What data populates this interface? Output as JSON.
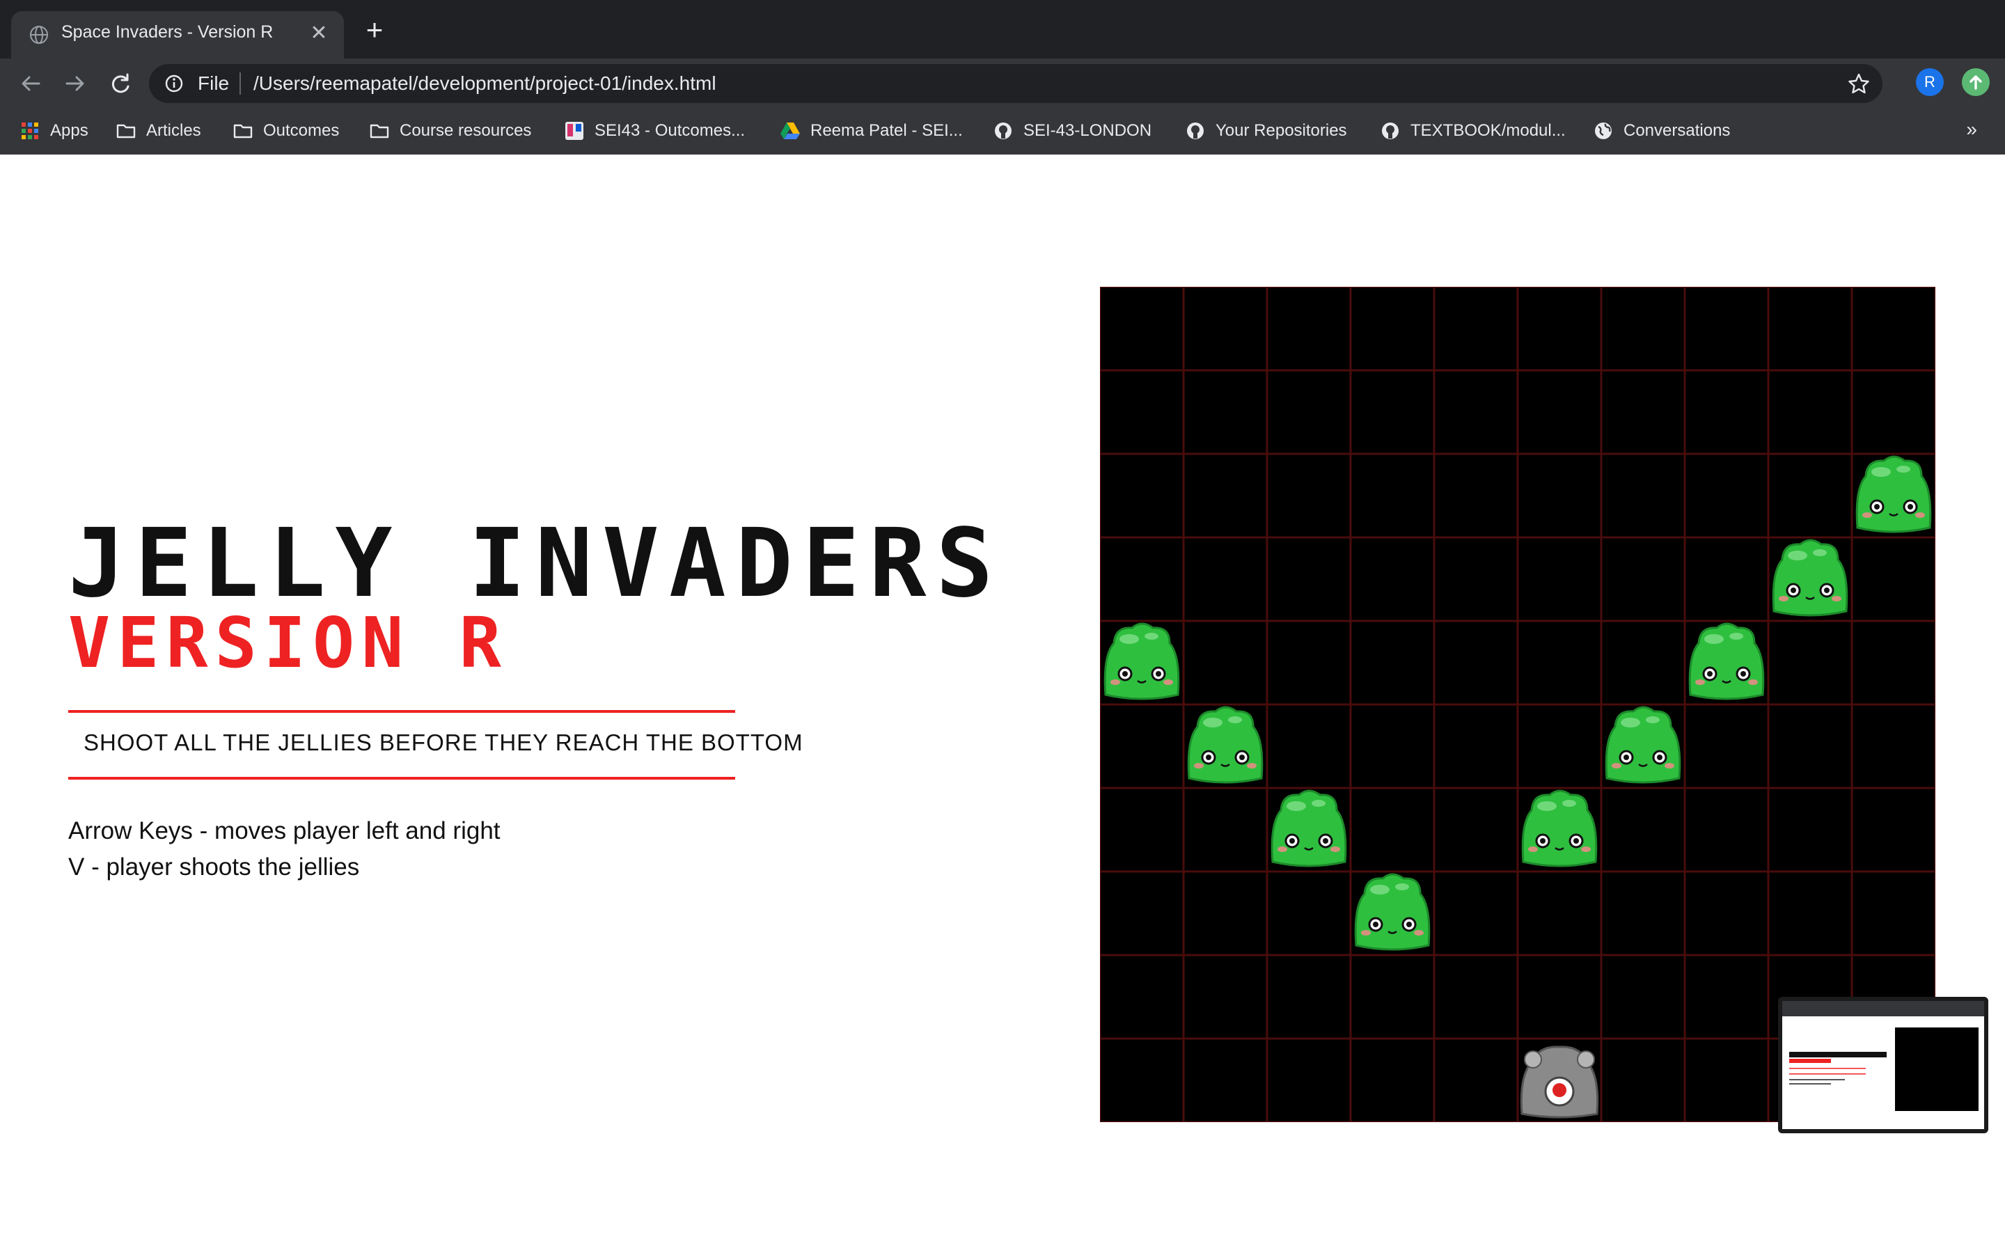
{
  "browser": {
    "tab": {
      "title": "Space Invaders - Version R",
      "close_label": "✕"
    },
    "new_tab_label": "+",
    "address": {
      "scheme": "File",
      "url": "/Users/reemapatel/development/project-01/index.html"
    },
    "profile_initial": "R",
    "bookmarks": [
      {
        "label": "Apps",
        "icon": "apps-grid-icon"
      },
      {
        "label": "Articles",
        "icon": "folder-icon"
      },
      {
        "label": "Outcomes",
        "icon": "folder-icon"
      },
      {
        "label": "Course resources",
        "icon": "folder-icon"
      },
      {
        "label": "SEI43 - Outcomes...",
        "icon": "trello-icon"
      },
      {
        "label": "Reema Patel - SEI...",
        "icon": "google-drive-icon"
      },
      {
        "label": "SEI-43-LONDON",
        "icon": "github-icon"
      },
      {
        "label": "Your Repositories",
        "icon": "github-icon"
      },
      {
        "label": "TEXTBOOK/modul...",
        "icon": "github-icon"
      },
      {
        "label": "Conversations",
        "icon": "globe-icon"
      }
    ],
    "more_label": "»"
  },
  "page": {
    "title": "JELLY INVADERS",
    "subtitle": "VERSION R",
    "tagline": "SHOOT ALL THE JELLIES BEFORE THEY REACH THE BOTTOM",
    "instructions": [
      "Arrow Keys - moves player left and right",
      "V - player shoots the jellies"
    ]
  },
  "game": {
    "rows": 10,
    "cols": 10,
    "colors": {
      "background": "#000000",
      "grid_line": "#4a0c0c",
      "jelly": "#2fbf3f",
      "player": "#8a8a8a",
      "accent": "#ee2222"
    },
    "jellies": [
      {
        "row": 2,
        "col": 9
      },
      {
        "row": 3,
        "col": 8
      },
      {
        "row": 4,
        "col": 0
      },
      {
        "row": 4,
        "col": 7
      },
      {
        "row": 5,
        "col": 1
      },
      {
        "row": 5,
        "col": 6
      },
      {
        "row": 6,
        "col": 2
      },
      {
        "row": 6,
        "col": 5
      },
      {
        "row": 7,
        "col": 3
      }
    ],
    "player": {
      "row": 9,
      "col": 5
    }
  }
}
